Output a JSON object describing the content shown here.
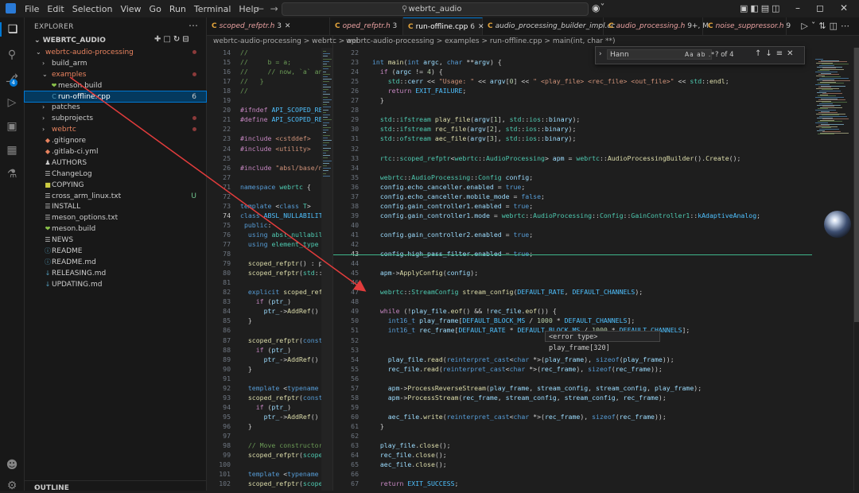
{
  "menu": [
    "File",
    "Edit",
    "Selection",
    "View",
    "Go",
    "Run",
    "Terminal",
    "Help"
  ],
  "command_center": "webrtc_audio",
  "sidebar": {
    "title": "EXPLORER",
    "root": "WEBRTC_AUDIO",
    "items": [
      {
        "label": "webrtc-audio-processing",
        "indent": 1,
        "chev": "v",
        "color": "#e8835f",
        "dot": true
      },
      {
        "label": "build_arm",
        "indent": 2,
        "chev": ">",
        "color": "#cccccc"
      },
      {
        "label": "examples",
        "indent": 2,
        "chev": "v",
        "color": "#e8835f",
        "dot": true
      },
      {
        "label": "meson.build",
        "indent": 3,
        "icon": "meson",
        "color": "#cccccc"
      },
      {
        "label": "run-offline.cpp",
        "indent": 3,
        "icon": "cpp",
        "color": "#ffffff",
        "status": "6",
        "selected": true
      },
      {
        "label": "patches",
        "indent": 2,
        "chev": ">",
        "color": "#cccccc"
      },
      {
        "label": "subprojects",
        "indent": 2,
        "chev": ">",
        "color": "#cccccc",
        "dot": true
      },
      {
        "label": "webrtc",
        "indent": 2,
        "chev": ">",
        "color": "#e8835f",
        "dot": true
      },
      {
        "label": ".gitignore",
        "indent": 2,
        "icon": "git",
        "color": "#cccccc"
      },
      {
        "label": ".gitlab-ci.yml",
        "indent": 2,
        "icon": "gitlab",
        "color": "#cccccc"
      },
      {
        "label": "AUTHORS",
        "indent": 2,
        "icon": "people",
        "color": "#cccccc"
      },
      {
        "label": "ChangeLog",
        "indent": 2,
        "icon": "file",
        "color": "#cccccc"
      },
      {
        "label": "COPYING",
        "indent": 2,
        "icon": "license",
        "color": "#cccccc"
      },
      {
        "label": "cross_arm_linux.txt",
        "indent": 2,
        "icon": "text",
        "color": "#cccccc",
        "status": "U"
      },
      {
        "label": "INSTALL",
        "indent": 2,
        "icon": "file",
        "color": "#cccccc"
      },
      {
        "label": "meson_options.txt",
        "indent": 2,
        "icon": "text",
        "color": "#cccccc"
      },
      {
        "label": "meson.build",
        "indent": 2,
        "icon": "meson",
        "color": "#cccccc"
      },
      {
        "label": "NEWS",
        "indent": 2,
        "icon": "file",
        "color": "#cccccc"
      },
      {
        "label": "README",
        "indent": 2,
        "icon": "info",
        "color": "#cccccc"
      },
      {
        "label": "README.md",
        "indent": 2,
        "icon": "info",
        "color": "#cccccc"
      },
      {
        "label": "RELEASING.md",
        "indent": 2,
        "icon": "md",
        "color": "#cccccc"
      },
      {
        "label": "UPDATING.md",
        "indent": 2,
        "icon": "md",
        "color": "#cccccc"
      }
    ],
    "outline": "OUTLINE"
  },
  "tabs": [
    {
      "label": "scoped_refptr.h",
      "count": "3",
      "active": false
    },
    {
      "label": "oped_refptr.h",
      "count": "3",
      "active": false
    },
    {
      "label": "run-offline.cpp",
      "count": "6",
      "active": true
    },
    {
      "label": "audio_processing_builder_impl.cc",
      "count": "",
      "active": false
    },
    {
      "label": "audio_processing.h",
      "count": "9+, M",
      "active": false
    },
    {
      "label": "noise_suppressor.h",
      "count": "9",
      "active": false
    }
  ],
  "breadcrumb_left": "webrtc-audio-processing > webrtc > api",
  "breadcrumb_right": "webrtc-audio-processing > examples > run-offline.cpp > main(int, char **)",
  "find": {
    "query": "Hann",
    "opts": "Aa  ab  .*",
    "count": "? of 4"
  },
  "hover": "<error type> play_frame[320]",
  "left_code": [
    {
      "n": "14",
      "h": "<span class='cm'>//</span>"
    },
    {
      "n": "15",
      "h": "<span class='cm'>//     b = a;</span>"
    },
    {
      "n": "16",
      "h": "<span class='cm'>//     // now, `a` and</span>"
    },
    {
      "n": "17",
      "h": "<span class='cm'>//   }</span>"
    },
    {
      "n": "18",
      "h": "<span class='cm'>//</span>"
    },
    {
      "n": "19",
      "h": ""
    },
    {
      "n": "20",
      "h": "<span class='d'>#ifndef</span> <span class='m'>API_SCOPED_REF</span>"
    },
    {
      "n": "21",
      "h": "<span class='d'>#define</span> <span class='m'>API_SCOPED_REF</span>"
    },
    {
      "n": "22",
      "h": ""
    },
    {
      "n": "23",
      "h": "<span class='d'>#include</span> <span class='s'>&lt;cstddef&gt;</span>"
    },
    {
      "n": "24",
      "h": "<span class='d'>#include</span> <span class='s'>&lt;utility&gt;</span>"
    },
    {
      "n": "25",
      "h": ""
    },
    {
      "n": "26",
      "h": "<span class='d'>#include</span> <span class='s'>\"absl/base/n</span>"
    },
    {
      "n": "27",
      "h": ""
    },
    {
      "n": "71",
      "h": "<span class='k'>namespace</span> <span class='t'>webrtc</span> {"
    },
    {
      "n": "72",
      "h": ""
    },
    {
      "n": "73",
      "h": "<span class='k'>template</span> &lt;<span class='k'>class</span> <span class='t'>T</span>&gt;"
    },
    {
      "n": "74",
      "h": "<span class='k'>class</span> <span class='m'>ABSL_NULLABILIT</span>",
      "cur": true
    },
    {
      "n": "75",
      "h": " <span class='k'>public</span>:"
    },
    {
      "n": "76",
      "h": "  <span class='k'>using</span> <span class='t'>absl_nullabil</span>"
    },
    {
      "n": "77",
      "h": "  <span class='k'>using</span> <span class='t'>element_type</span>"
    },
    {
      "n": "78",
      "h": ""
    },
    {
      "n": "79",
      "h": "  <span class='f'>scoped_refptr</span>() : p"
    },
    {
      "n": "80",
      "h": "  <span class='f'>scoped_refptr</span>(<span class='t'>std</span>::"
    },
    {
      "n": "81",
      "h": ""
    },
    {
      "n": "82",
      "h": "  <span class='k'>explicit</span> <span class='f'>scoped_ref</span>"
    },
    {
      "n": "83",
      "h": "    <span class='c'>if</span> (<span class='v'>ptr_</span>)"
    },
    {
      "n": "84",
      "h": "      <span class='v'>ptr_</span>-&gt;<span class='f'>AddRef</span>()"
    },
    {
      "n": "85",
      "h": "  }"
    },
    {
      "n": "86",
      "h": ""
    },
    {
      "n": "87",
      "h": "  <span class='f'>scoped_refptr</span>(<span class='k'>const</span>"
    },
    {
      "n": "88",
      "h": "    <span class='c'>if</span> (<span class='v'>ptr_</span>)"
    },
    {
      "n": "89",
      "h": "      <span class='v'>ptr_</span>-&gt;<span class='f'>AddRef</span>()"
    },
    {
      "n": "90",
      "h": "  }"
    },
    {
      "n": "91",
      "h": ""
    },
    {
      "n": "92",
      "h": "  <span class='k'>template</span> &lt;<span class='k'>typename</span>"
    },
    {
      "n": "93",
      "h": "  <span class='f'>scoped_refptr</span>(<span class='k'>const</span>"
    },
    {
      "n": "94",
      "h": "    <span class='c'>if</span> (<span class='v'>ptr_</span>)"
    },
    {
      "n": "95",
      "h": "      <span class='v'>ptr_</span>-&gt;<span class='f'>AddRef</span>()"
    },
    {
      "n": "96",
      "h": "  }"
    },
    {
      "n": "97",
      "h": ""
    },
    {
      "n": "98",
      "h": "  <span class='cm'>// Move constructor</span>"
    },
    {
      "n": "99",
      "h": "  <span class='f'>scoped_refptr</span>(<span class='t'>scope</span>"
    },
    {
      "n": "100",
      "h": ""
    },
    {
      "n": "101",
      "h": "  <span class='k'>template</span> &lt;<span class='k'>typename</span>"
    },
    {
      "n": "102",
      "h": "  <span class='f'>scoped_refptr</span>(<span class='t'>scope</span>"
    }
  ],
  "right_code": [
    {
      "n": "22",
      "h": ""
    },
    {
      "n": "23",
      "h": "<span class='k'>int</span> <span class='f'>main</span>(<span class='k'>int</span> <span class='v'>argc</span>, <span class='k'>char</span> **<span class='v'>argv</span>) {"
    },
    {
      "n": "24",
      "h": "  <span class='c'>if</span> (<span class='v'>argc</span> != <span class='n'>4</span>) {"
    },
    {
      "n": "25",
      "h": "    <span class='t'>std</span>::<span class='v'>cerr</span> &lt;&lt; <span class='s'>\"Usage: \"</span> &lt;&lt; <span class='v'>argv</span>[<span class='n'>0</span>] &lt;&lt; <span class='s'>\" &lt;play_file&gt; &lt;rec_file&gt; &lt;out_file&gt;\"</span> &lt;&lt; <span class='t'>std</span>::<span class='f'>endl</span>;"
    },
    {
      "n": "26",
      "h": "    <span class='c'>return</span> <span class='m'>EXIT_FAILURE</span>;"
    },
    {
      "n": "27",
      "h": "  }"
    },
    {
      "n": "28",
      "h": ""
    },
    {
      "n": "29",
      "h": "  <span class='t'>std</span>::<span class='t'>ifstream</span> <span class='f'>play_file</span>(<span class='v'>argv</span>[<span class='n'>1</span>], <span class='t'>std</span>::<span class='t'>ios</span>::<span class='v'>binary</span>);"
    },
    {
      "n": "30",
      "h": "  <span class='t'>std</span>::<span class='t'>ifstream</span> <span class='f'>rec_file</span>(<span class='v'>argv</span>[<span class='n'>2</span>], <span class='t'>std</span>::<span class='t'>ios</span>::<span class='v'>binary</span>);"
    },
    {
      "n": "31",
      "h": "  <span class='t'>std</span>::<span class='t'>ofstream</span> <span class='f'>aec_file</span>(<span class='v'>argv</span>[<span class='n'>3</span>], <span class='t'>std</span>::<span class='t'>ios</span>::<span class='v'>binary</span>);"
    },
    {
      "n": "32",
      "h": ""
    },
    {
      "n": "33",
      "h": "  <span class='t'>rtc</span>::<span class='t'>scoped_refptr</span>&lt;<span class='t'>webrtc</span>::<span class='t'>AudioProcessing</span>&gt; <span class='v'>apm</span> = <span class='t'>webrtc</span>::<span class='f'>AudioProcessingBuilder</span>().<span class='f'>Create</span>();"
    },
    {
      "n": "34",
      "h": ""
    },
    {
      "n": "35",
      "h": "  <span class='t'>webrtc</span>::<span class='t'>AudioProcessing</span>::<span class='t'>Config</span> <span class='v'>config</span>;"
    },
    {
      "n": "36",
      "h": "  <span class='v'>config</span>.<span class='v'>echo_canceller</span>.<span class='v'>enabled</span> = <span class='k'>true</span>;"
    },
    {
      "n": "37",
      "h": "  <span class='v'>config</span>.<span class='v'>echo_canceller</span>.<span class='v'>mobile_mode</span> = <span class='k'>false</span>;"
    },
    {
      "n": "38",
      "h": "  <span class='v'>config</span>.<span class='v'>gain_controller1</span>.<span class='v'>enabled</span> = <span class='k'>true</span>;"
    },
    {
      "n": "39",
      "h": "  <span class='v'>config</span>.<span class='v'>gain_controller1</span>.<span class='v'>mode</span> = <span class='t'>webrtc</span>::<span class='t'>AudioProcessing</span>::<span class='t'>Config</span>::<span class='t'>GainController1</span>::<span class='m'>kAdaptiveAnalog</span>;"
    },
    {
      "n": "40",
      "h": ""
    },
    {
      "n": "41",
      "h": "  <span class='v'>config</span>.<span class='v'>gain_controller2</span>.<span class='v'>enabled</span> = <span class='k'>true</span>;"
    },
    {
      "n": "42",
      "h": ""
    },
    {
      "n": "43",
      "h": "  <span class='v'>config</span>.<span class='v'>high_pass_filter</span>.<span class='v'>enabled</span> = <span class='k'>true</span>;",
      "cur": true
    },
    {
      "n": "44",
      "h": ""
    },
    {
      "n": "45",
      "h": "  <span class='v'>apm</span>-&gt;<span class='f'>ApplyConfig</span>(<span class='v'>config</span>);"
    },
    {
      "n": "46",
      "h": ""
    },
    {
      "n": "47",
      "h": "  <span class='t'>webrtc</span>::<span class='t'>StreamConfig</span> <span class='f'>stream_config</span>(<span class='m'>DEFAULT_RATE</span>, <span class='m'>DEFAULT_CHANNELS</span>);"
    },
    {
      "n": "48",
      "h": ""
    },
    {
      "n": "49",
      "h": "  <span class='c'>while</span> (!<span class='v'>play_file</span>.<span class='f'>eof</span>() &amp;&amp; !<span class='v'>rec_file</span>.<span class='f'>eof</span>()) {"
    },
    {
      "n": "50",
      "h": "    <span class='k'>int16_t</span> <span class='v'>play_frame</span>[<span class='m'>DEFAULT_BLOCK_MS</span> / <span class='n'>1000</span> * <span class='m'>DEFAULT_CHANNELS</span>];"
    },
    {
      "n": "51",
      "h": "    <span class='k'>int16_t</span> <span class='v'>rec_frame</span>[<span class='m'>DEFAULT_RATE</span> * <span class='m'>DEFAULT_BLOCK_MS</span> / <span class='n'>1000</span> * <span class='m'>DEFAULT_CHANNELS</span>];"
    },
    {
      "n": "52",
      "h": ""
    },
    {
      "n": "53",
      "h": ""
    },
    {
      "n": "54",
      "h": "    <span class='v'>play_file</span>.<span class='f'>read</span>(<span class='k'>reinterpret_cast</span>&lt;<span class='k'>char</span> *&gt;(<span class='v'>play_frame</span>), <span class='k'>sizeof</span>(<span class='v'>play_frame</span>));"
    },
    {
      "n": "55",
      "h": "    <span class='v'>rec_file</span>.<span class='f'>read</span>(<span class='k'>reinterpret_cast</span>&lt;<span class='k'>char</span> *&gt;(<span class='v'>rec_frame</span>), <span class='k'>sizeof</span>(<span class='v'>rec_frame</span>));"
    },
    {
      "n": "56",
      "h": ""
    },
    {
      "n": "57",
      "h": "    <span class='v'>apm</span>-&gt;<span class='f'>ProcessReverseStream</span>(<span class='v'>play_frame</span>, <span class='v'>stream_config</span>, <span class='v'>stream_config</span>, <span class='v'>play_frame</span>);"
    },
    {
      "n": "58",
      "h": "    <span class='v'>apm</span>-&gt;<span class='f'>ProcessStream</span>(<span class='v'>rec_frame</span>, <span class='v'>stream_config</span>, <span class='v'>stream_config</span>, <span class='v'>rec_frame</span>);"
    },
    {
      "n": "59",
      "h": ""
    },
    {
      "n": "60",
      "h": "    <span class='v'>aec_file</span>.<span class='f'>write</span>(<span class='k'>reinterpret_cast</span>&lt;<span class='k'>char</span> *&gt;(<span class='v'>rec_frame</span>), <span class='k'>sizeof</span>(<span class='v'>rec_frame</span>));"
    },
    {
      "n": "61",
      "h": "  }"
    },
    {
      "n": "62",
      "h": ""
    },
    {
      "n": "63",
      "h": "  <span class='v'>play_file</span>.<span class='f'>close</span>();"
    },
    {
      "n": "64",
      "h": "  <span class='v'>rec_file</span>.<span class='f'>close</span>();"
    },
    {
      "n": "65",
      "h": "  <span class='v'>aec_file</span>.<span class='f'>close</span>();"
    },
    {
      "n": "66",
      "h": ""
    },
    {
      "n": "67",
      "h": "  <span class='c'>return</span> <span class='m'>EXIT_SUCCESS</span>;"
    },
    {
      "n": "68",
      "h": "}"
    }
  ]
}
